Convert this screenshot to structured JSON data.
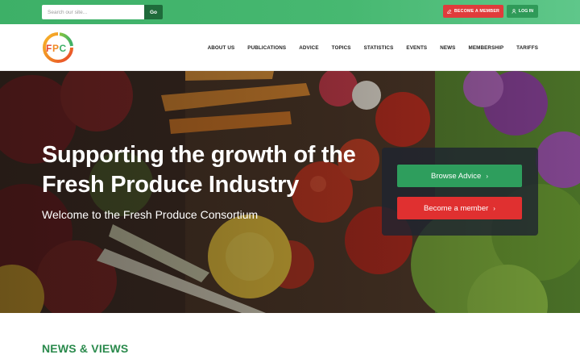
{
  "topbar": {
    "search_placeholder": "Search our site...",
    "search_button": "Go",
    "become_member": "BECOME A MEMBER",
    "log_in": "LOG IN"
  },
  "header": {
    "logo_text": "FPC",
    "nav": [
      "ABOUT US",
      "PUBLICATIONS",
      "ADVICE",
      "TOPICS",
      "STATISTICS",
      "EVENTS",
      "NEWS",
      "MEMBERSHIP",
      "TARIFFS"
    ]
  },
  "hero": {
    "title": "Supporting the growth of the Fresh Produce Industry",
    "subtitle": "Welcome to the Fresh Produce Consortium",
    "browse_label": "Browse Advice",
    "become_label": "Become a member"
  },
  "news": {
    "heading": "NEWS & VIEWS"
  },
  "colors": {
    "green_bar": "#47b871",
    "dark_green": "#1f6b3b",
    "red": "#e03c3c",
    "heading_green": "#2a8a4c"
  }
}
